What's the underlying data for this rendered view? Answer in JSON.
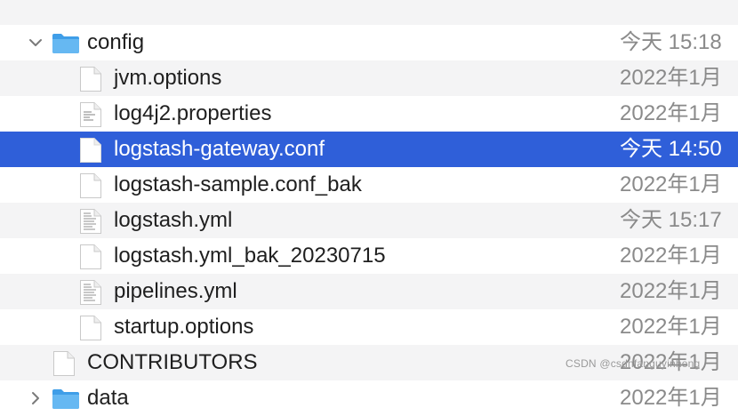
{
  "rows": [
    {
      "name": "",
      "date": "",
      "icon": "folder-icon"
    },
    {
      "name": "config",
      "date": "今天 15:18",
      "icon": "folder-icon",
      "expanded": true
    },
    {
      "name": "jvm.options",
      "date": "2022年1月",
      "icon": "document-icon"
    },
    {
      "name": "log4j2.properties",
      "date": "2022年1月",
      "icon": "text-document-icon"
    },
    {
      "name": "logstash-gateway.conf",
      "date": "今天 14:50",
      "icon": "document-icon",
      "selected": true
    },
    {
      "name": "logstash-sample.conf_bak",
      "date": "2022年1月",
      "icon": "document-icon"
    },
    {
      "name": "logstash.yml",
      "date": "今天 15:17",
      "icon": "text-document-icon"
    },
    {
      "name": "logstash.yml_bak_20230715",
      "date": "2022年1月",
      "icon": "document-icon"
    },
    {
      "name": "pipelines.yml",
      "date": "2022年1月",
      "icon": "text-document-icon"
    },
    {
      "name": "startup.options",
      "date": "2022年1月",
      "icon": "document-icon"
    },
    {
      "name": "CONTRIBUTORS",
      "date": "2022年1月",
      "icon": "document-icon"
    },
    {
      "name": "data",
      "date": "2022年1月",
      "icon": "folder-icon",
      "expanded": false
    }
  ],
  "watermark": "CSDN @csdnfanguyinheng",
  "colors": {
    "selection": "#2f5fd9",
    "folder": "#5ab0f0",
    "stripe": "#f4f4f5"
  }
}
